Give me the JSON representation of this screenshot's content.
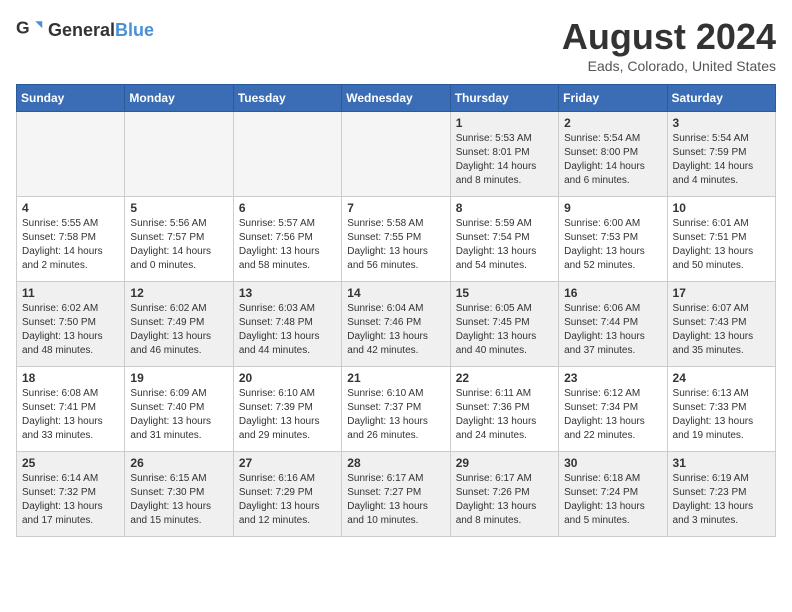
{
  "header": {
    "logo_general": "General",
    "logo_blue": "Blue",
    "month": "August 2024",
    "location": "Eads, Colorado, United States"
  },
  "days_of_week": [
    "Sunday",
    "Monday",
    "Tuesday",
    "Wednesday",
    "Thursday",
    "Friday",
    "Saturday"
  ],
  "weeks": [
    [
      {
        "day": "",
        "info": ""
      },
      {
        "day": "",
        "info": ""
      },
      {
        "day": "",
        "info": ""
      },
      {
        "day": "",
        "info": ""
      },
      {
        "day": "1",
        "info": "Sunrise: 5:53 AM\nSunset: 8:01 PM\nDaylight: 14 hours\nand 8 minutes."
      },
      {
        "day": "2",
        "info": "Sunrise: 5:54 AM\nSunset: 8:00 PM\nDaylight: 14 hours\nand 6 minutes."
      },
      {
        "day": "3",
        "info": "Sunrise: 5:54 AM\nSunset: 7:59 PM\nDaylight: 14 hours\nand 4 minutes."
      }
    ],
    [
      {
        "day": "4",
        "info": "Sunrise: 5:55 AM\nSunset: 7:58 PM\nDaylight: 14 hours\nand 2 minutes."
      },
      {
        "day": "5",
        "info": "Sunrise: 5:56 AM\nSunset: 7:57 PM\nDaylight: 14 hours\nand 0 minutes."
      },
      {
        "day": "6",
        "info": "Sunrise: 5:57 AM\nSunset: 7:56 PM\nDaylight: 13 hours\nand 58 minutes."
      },
      {
        "day": "7",
        "info": "Sunrise: 5:58 AM\nSunset: 7:55 PM\nDaylight: 13 hours\nand 56 minutes."
      },
      {
        "day": "8",
        "info": "Sunrise: 5:59 AM\nSunset: 7:54 PM\nDaylight: 13 hours\nand 54 minutes."
      },
      {
        "day": "9",
        "info": "Sunrise: 6:00 AM\nSunset: 7:53 PM\nDaylight: 13 hours\nand 52 minutes."
      },
      {
        "day": "10",
        "info": "Sunrise: 6:01 AM\nSunset: 7:51 PM\nDaylight: 13 hours\nand 50 minutes."
      }
    ],
    [
      {
        "day": "11",
        "info": "Sunrise: 6:02 AM\nSunset: 7:50 PM\nDaylight: 13 hours\nand 48 minutes."
      },
      {
        "day": "12",
        "info": "Sunrise: 6:02 AM\nSunset: 7:49 PM\nDaylight: 13 hours\nand 46 minutes."
      },
      {
        "day": "13",
        "info": "Sunrise: 6:03 AM\nSunset: 7:48 PM\nDaylight: 13 hours\nand 44 minutes."
      },
      {
        "day": "14",
        "info": "Sunrise: 6:04 AM\nSunset: 7:46 PM\nDaylight: 13 hours\nand 42 minutes."
      },
      {
        "day": "15",
        "info": "Sunrise: 6:05 AM\nSunset: 7:45 PM\nDaylight: 13 hours\nand 40 minutes."
      },
      {
        "day": "16",
        "info": "Sunrise: 6:06 AM\nSunset: 7:44 PM\nDaylight: 13 hours\nand 37 minutes."
      },
      {
        "day": "17",
        "info": "Sunrise: 6:07 AM\nSunset: 7:43 PM\nDaylight: 13 hours\nand 35 minutes."
      }
    ],
    [
      {
        "day": "18",
        "info": "Sunrise: 6:08 AM\nSunset: 7:41 PM\nDaylight: 13 hours\nand 33 minutes."
      },
      {
        "day": "19",
        "info": "Sunrise: 6:09 AM\nSunset: 7:40 PM\nDaylight: 13 hours\nand 31 minutes."
      },
      {
        "day": "20",
        "info": "Sunrise: 6:10 AM\nSunset: 7:39 PM\nDaylight: 13 hours\nand 29 minutes."
      },
      {
        "day": "21",
        "info": "Sunrise: 6:10 AM\nSunset: 7:37 PM\nDaylight: 13 hours\nand 26 minutes."
      },
      {
        "day": "22",
        "info": "Sunrise: 6:11 AM\nSunset: 7:36 PM\nDaylight: 13 hours\nand 24 minutes."
      },
      {
        "day": "23",
        "info": "Sunrise: 6:12 AM\nSunset: 7:34 PM\nDaylight: 13 hours\nand 22 minutes."
      },
      {
        "day": "24",
        "info": "Sunrise: 6:13 AM\nSunset: 7:33 PM\nDaylight: 13 hours\nand 19 minutes."
      }
    ],
    [
      {
        "day": "25",
        "info": "Sunrise: 6:14 AM\nSunset: 7:32 PM\nDaylight: 13 hours\nand 17 minutes."
      },
      {
        "day": "26",
        "info": "Sunrise: 6:15 AM\nSunset: 7:30 PM\nDaylight: 13 hours\nand 15 minutes."
      },
      {
        "day": "27",
        "info": "Sunrise: 6:16 AM\nSunset: 7:29 PM\nDaylight: 13 hours\nand 12 minutes."
      },
      {
        "day": "28",
        "info": "Sunrise: 6:17 AM\nSunset: 7:27 PM\nDaylight: 13 hours\nand 10 minutes."
      },
      {
        "day": "29",
        "info": "Sunrise: 6:17 AM\nSunset: 7:26 PM\nDaylight: 13 hours\nand 8 minutes."
      },
      {
        "day": "30",
        "info": "Sunrise: 6:18 AM\nSunset: 7:24 PM\nDaylight: 13 hours\nand 5 minutes."
      },
      {
        "day": "31",
        "info": "Sunrise: 6:19 AM\nSunset: 7:23 PM\nDaylight: 13 hours\nand 3 minutes."
      }
    ]
  ]
}
